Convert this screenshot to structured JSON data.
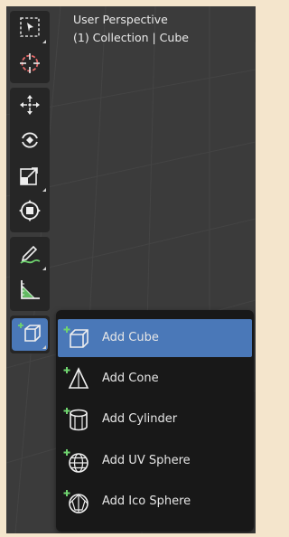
{
  "viewport": {
    "title": "User Perspective",
    "subtitle": "(1) Collection | Cube"
  },
  "toolbar": {
    "tools": [
      {
        "name": "select-box",
        "icon": "select-box-icon"
      },
      {
        "name": "cursor",
        "icon": "cursor-icon"
      },
      {
        "name": "move",
        "icon": "move-icon"
      },
      {
        "name": "rotate",
        "icon": "rotate-icon"
      },
      {
        "name": "scale",
        "icon": "scale-icon"
      },
      {
        "name": "transform",
        "icon": "transform-icon"
      },
      {
        "name": "annotate",
        "icon": "annotate-icon"
      },
      {
        "name": "measure",
        "icon": "measure-icon"
      },
      {
        "name": "add-cube",
        "icon": "add-cube-icon",
        "active": true
      }
    ]
  },
  "add_menu": {
    "items": [
      {
        "label": "Add Cube",
        "icon": "cube-icon",
        "active": true
      },
      {
        "label": "Add Cone",
        "icon": "cone-icon"
      },
      {
        "label": "Add Cylinder",
        "icon": "cylinder-icon"
      },
      {
        "label": "Add UV Sphere",
        "icon": "uv-sphere-icon"
      },
      {
        "label": "Add Ico Sphere",
        "icon": "ico-sphere-icon"
      }
    ]
  },
  "colors": {
    "accent": "#4a78b8",
    "icon_green": "#6fd46f",
    "viewport_bg": "#3b3b3b",
    "panel_bg": "#262626",
    "menu_bg": "#181818"
  }
}
